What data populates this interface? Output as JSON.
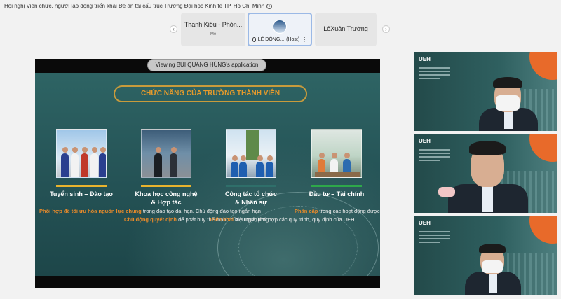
{
  "meeting": {
    "title": "Hội nghị Viên chức, người lao động triển khai Đề án tái cấu trúc Trường Đại học Kinh tế TP. Hồ Chí Minh"
  },
  "participants": {
    "prev_arrow": "‹",
    "next_arrow": "›",
    "tiles": [
      {
        "name": "Thanh Kiều - Phòn...",
        "sub": "Me"
      },
      {
        "name": "LÊ ĐÔNG...",
        "role": "(Host)"
      },
      {
        "name": "LêXuân Trường"
      }
    ]
  },
  "share": {
    "viewing_label": "Viewing BÙI QUANG HÙNG's application"
  },
  "slide": {
    "title": "CHỨC NĂNG CỦA TRƯỜNG THÀNH VIÊN",
    "columns": [
      {
        "bar_color": "#e8b32e",
        "title_l1": "Tuyển sinh – Đào tạo",
        "title_l2": "",
        "desc_hl": "Phối hợp để tối ưu hóa nguồn lực chung",
        "desc_rest": " trong đào tạo dài hạn. Chủ động đào tạo ngắn hạn"
      },
      {
        "bar_color": "#e8b32e",
        "title_l1": "Khoa học công nghệ",
        "title_l2": "& Hợp tác",
        "desc_hl": "Chủ động quyết định",
        "desc_rest": " để phát huy thế mạnh của từng trường"
      },
      {
        "bar_color": "#2f6f6a",
        "title_l1": "Công tác tổ chức",
        "title_l2": "& Nhân sự",
        "desc_hl": "Triển khai",
        "desc_rest": " hiệu quả, phù hợp các quy trình, quy định của UEH"
      },
      {
        "bar_color": "#2ea84a",
        "title_l1": "Đầu tư – Tài chính",
        "title_l2": "",
        "desc_hl": "Phân cấp",
        "desc_rest": " trong các hoạt động được ủy quyền và theo khả năng"
      }
    ]
  },
  "videos": [
    {
      "logo": "UEH"
    },
    {
      "logo": "UEH"
    },
    {
      "logo": "UEH"
    }
  ],
  "colors": {
    "accent_orange": "#e88a2a",
    "title_border": "#c89b3c",
    "slide_bg": "#2a5c5e",
    "active_tile_border": "#9bb9e6"
  }
}
